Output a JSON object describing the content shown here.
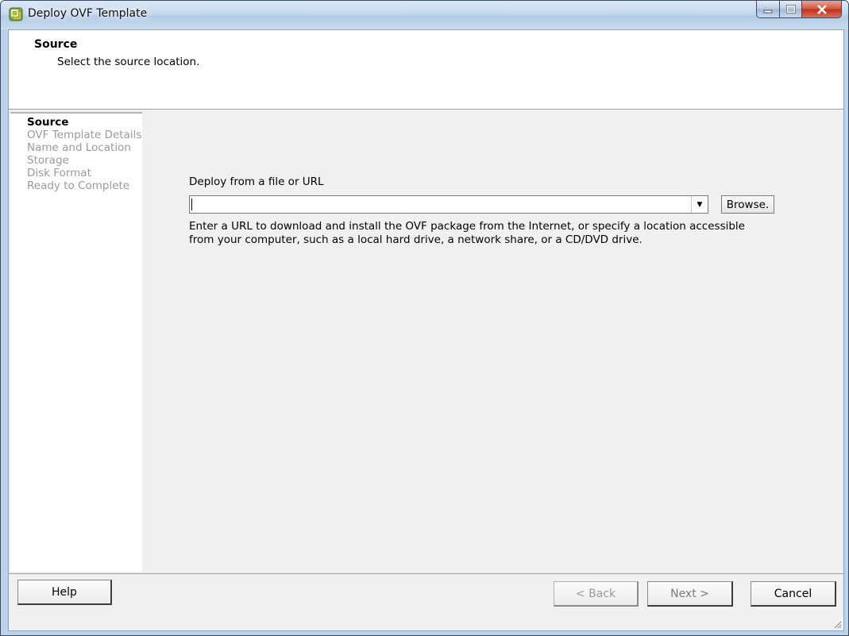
{
  "window": {
    "title": "Deploy OVF Template",
    "icon": "vsphere-app-icon"
  },
  "header": {
    "title": "Source",
    "subtitle": "Select the source location."
  },
  "nav": {
    "items": [
      {
        "label": "Source",
        "active": true
      },
      {
        "label": "OVF Template Details",
        "active": false
      },
      {
        "label": "Name and Location",
        "active": false
      },
      {
        "label": "Storage",
        "active": false
      },
      {
        "label": "Disk Format",
        "active": false
      },
      {
        "label": "Ready to Complete",
        "active": false
      }
    ]
  },
  "source": {
    "label": "Deploy from a file or URL",
    "url_value": "",
    "browse_label": "Browse.",
    "help_text": "Enter a URL to download and install the OVF package from the Internet, or specify a location accessible from your computer, such as a local hard drive, a network share, or a CD/DVD drive."
  },
  "footer": {
    "help": "Help",
    "back": "< Back",
    "next": "Next >",
    "cancel": "Cancel"
  }
}
